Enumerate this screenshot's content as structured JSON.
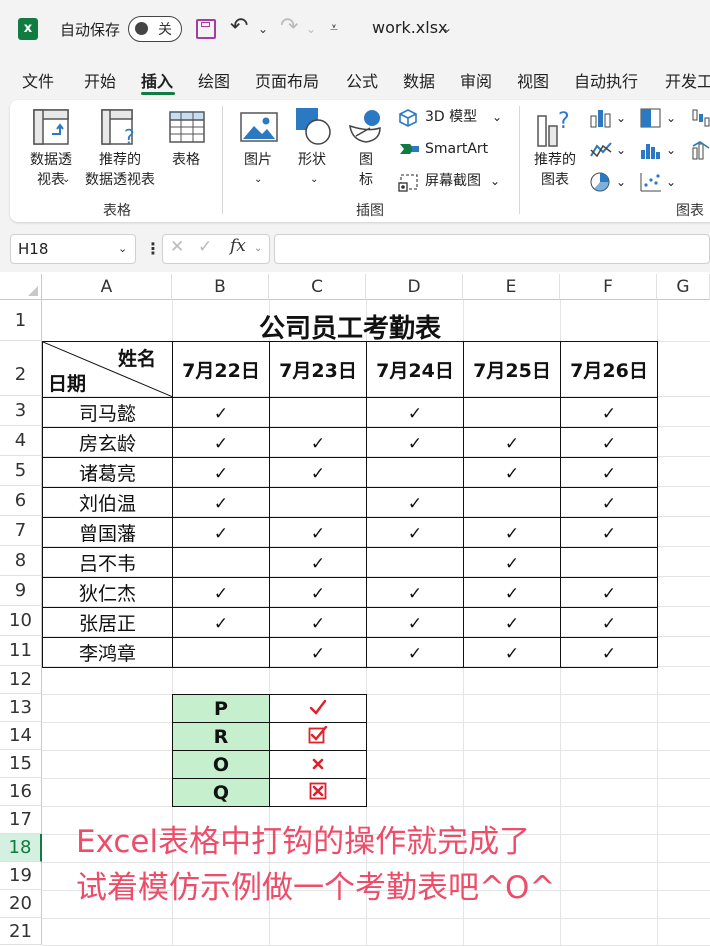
{
  "window": {
    "autosave_label": "自动保存",
    "autosave_state": "关",
    "filename": "work.xlsx"
  },
  "tabs": [
    "文件",
    "开始",
    "插入",
    "绘图",
    "页面布局",
    "公式",
    "数据",
    "审阅",
    "视图",
    "自动执行",
    "开发工"
  ],
  "active_tab": "插入",
  "ribbon": {
    "pivot_table": "数据透\n视表",
    "recommended_pivot": "推荐的\n数据透视表",
    "table": "表格",
    "group_tables": "表格",
    "pictures": "图片",
    "shapes": "形状",
    "icons": "图\n标",
    "model_3d": "3D 模型",
    "smartart": "SmartArt",
    "screenshot": "屏幕截图",
    "group_illustrations": "插图",
    "recommended_charts": "推荐的\n图表",
    "group_charts": "图表"
  },
  "formula_bar": {
    "name_box": "H18",
    "fx": "fx",
    "value": ""
  },
  "columns": [
    "A",
    "B",
    "C",
    "D",
    "E",
    "F",
    "G"
  ],
  "rows": [
    "1",
    "2",
    "3",
    "4",
    "5",
    "6",
    "7",
    "8",
    "9",
    "10",
    "11",
    "12",
    "13",
    "14",
    "15",
    "16",
    "17",
    "18",
    "19",
    "20",
    "21"
  ],
  "selected_row": "18",
  "sheet": {
    "title": "公司员工考勤表",
    "corner_name": "姓名",
    "corner_date": "日期",
    "dates": [
      "7月22日",
      "7月23日",
      "7月24日",
      "7月25日",
      "7月26日"
    ],
    "check_mark": "✓",
    "employees": [
      {
        "name": "司马懿",
        "att": [
          true,
          false,
          true,
          false,
          true
        ]
      },
      {
        "name": "房玄龄",
        "att": [
          true,
          true,
          true,
          true,
          true
        ]
      },
      {
        "name": "诸葛亮",
        "att": [
          true,
          true,
          false,
          true,
          true
        ]
      },
      {
        "name": "刘伯温",
        "att": [
          true,
          false,
          true,
          false,
          true
        ]
      },
      {
        "name": "曾国藩",
        "att": [
          true,
          true,
          true,
          true,
          true
        ]
      },
      {
        "name": "吕不韦",
        "att": [
          false,
          true,
          false,
          true,
          false
        ]
      },
      {
        "name": "狄仁杰",
        "att": [
          true,
          true,
          true,
          true,
          true
        ]
      },
      {
        "name": "张居正",
        "att": [
          true,
          true,
          true,
          true,
          true
        ]
      },
      {
        "name": "李鸿章",
        "att": [
          false,
          true,
          true,
          true,
          true
        ]
      }
    ],
    "legend": [
      {
        "letter": "P",
        "icon": "check-icon",
        "color": "#e0202a"
      },
      {
        "letter": "R",
        "icon": "boxed-check-icon",
        "color": "#e0202a"
      },
      {
        "letter": "O",
        "icon": "cross-icon",
        "color": "#e0202a"
      },
      {
        "letter": "Q",
        "icon": "boxed-cross-icon",
        "color": "#e0202a"
      }
    ],
    "note_line1": "Excel表格中打钩的操作就完成了",
    "note_line2": "试着模仿示例做一个考勤表吧^O^"
  },
  "colors": {
    "excel_green": "#107c41",
    "legend_fill": "#c6efce",
    "note": "#ee4d6a",
    "mark_red": "#e0202a"
  }
}
